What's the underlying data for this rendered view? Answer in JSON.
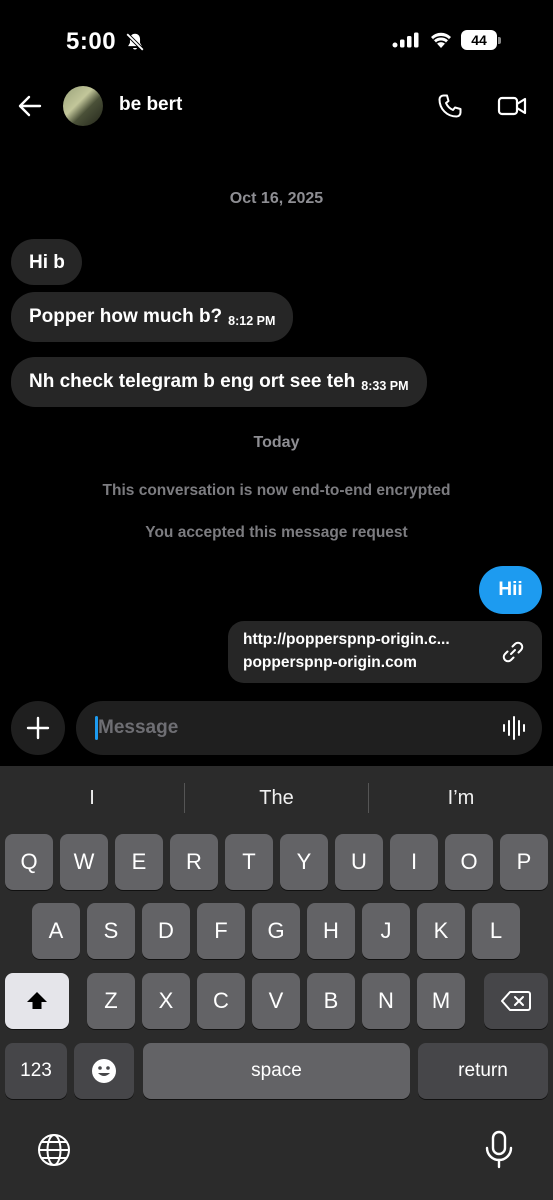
{
  "status_bar": {
    "time": "5:00",
    "battery": "44"
  },
  "header": {
    "contact_name": "be bert"
  },
  "thread": {
    "date_label": "Oct 16, 2025",
    "incoming": [
      {
        "text": "Hi b",
        "time": ""
      },
      {
        "text": "Popper how much b?",
        "time": "8:12 PM"
      },
      {
        "text": "Nh check telegram b eng ort see teh",
        "time": "8:33 PM"
      }
    ],
    "today_label": "Today",
    "system_messages": [
      "This conversation is now end-to-end encrypted",
      "You accepted this message request"
    ],
    "outgoing": {
      "text": "Hii"
    },
    "link_card": {
      "url": "http://popperspnp-origin.c...",
      "domain": "popperspnp-origin.com"
    }
  },
  "composer": {
    "placeholder": "Message"
  },
  "keyboard": {
    "suggestions": [
      "I",
      "The",
      "I’m"
    ],
    "row1": [
      "Q",
      "W",
      "E",
      "R",
      "T",
      "Y",
      "U",
      "I",
      "O",
      "P"
    ],
    "row2": [
      "A",
      "S",
      "D",
      "F",
      "G",
      "H",
      "J",
      "K",
      "L"
    ],
    "row3": [
      "Z",
      "X",
      "C",
      "V",
      "B",
      "N",
      "M"
    ],
    "numbers_label": "123",
    "space_label": "space",
    "return_label": "return"
  },
  "colors": {
    "accent": "#1d9bf0",
    "bubble": "#262626",
    "background": "#000000"
  }
}
